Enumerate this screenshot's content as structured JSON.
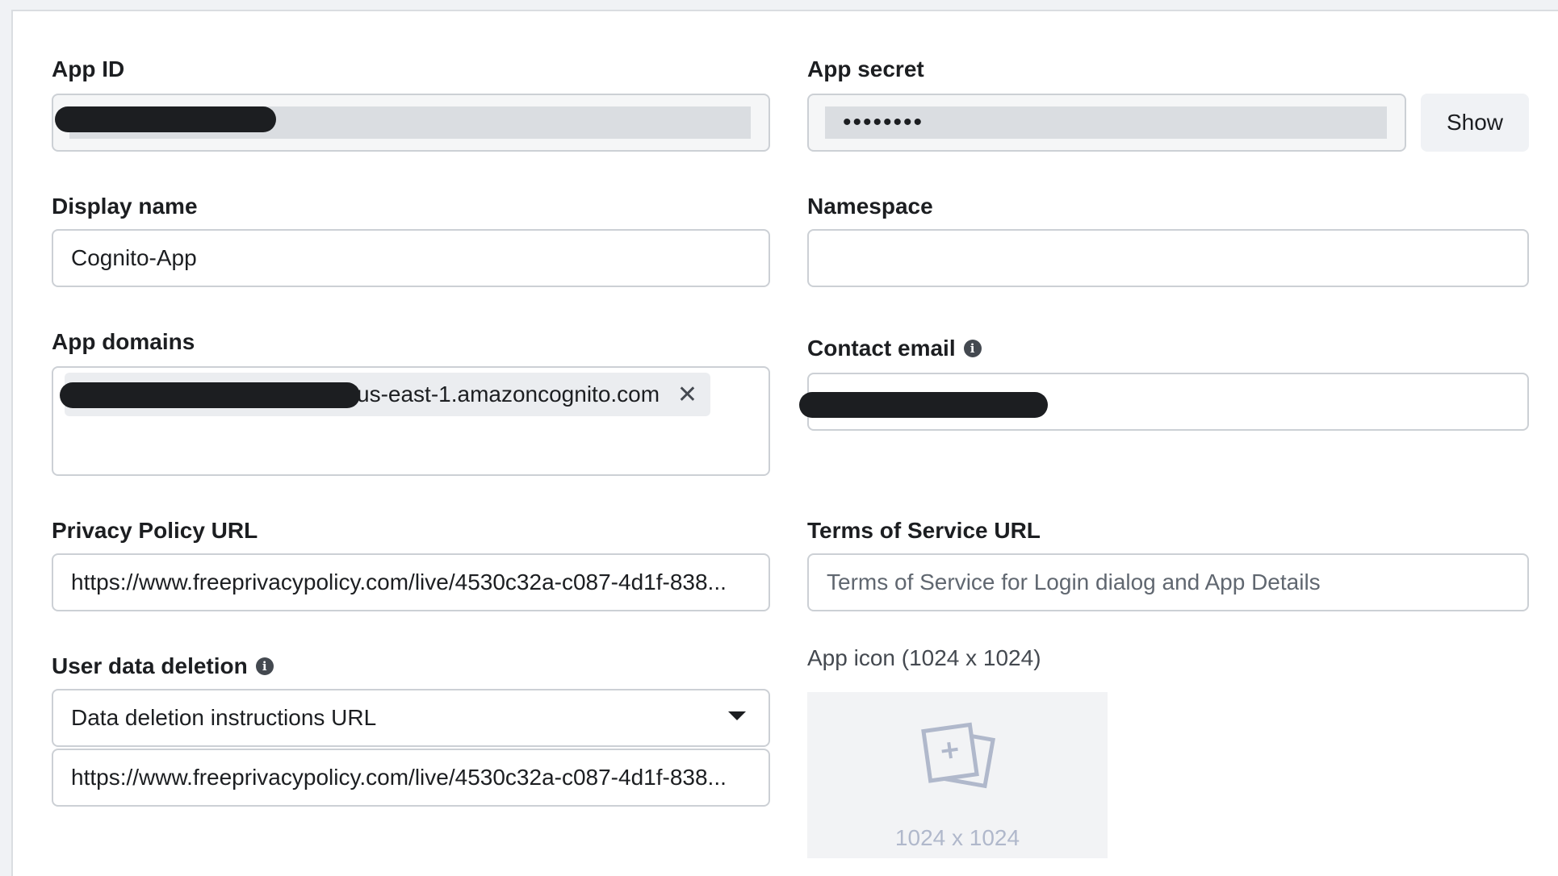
{
  "app_id": {
    "label": "App ID",
    "value": ""
  },
  "app_secret": {
    "label": "App secret",
    "value": "••••••••",
    "show_button": "Show"
  },
  "display_name": {
    "label": "Display name",
    "value": "Cognito-App"
  },
  "namespace": {
    "label": "Namespace",
    "value": ""
  },
  "app_domains": {
    "label": "App domains",
    "chips": [
      {
        "value": "us-east-1.amazoncognito.com"
      }
    ]
  },
  "contact_email": {
    "label": "Contact email",
    "value": ""
  },
  "privacy_policy_url": {
    "label": "Privacy Policy URL",
    "value": "https://www.freeprivacypolicy.com/live/4530c32a-c087-4d1f-838..."
  },
  "terms_of_service_url": {
    "label": "Terms of Service URL",
    "placeholder": "Terms of Service for Login dialog and App Details"
  },
  "user_data_deletion": {
    "label": "User data deletion",
    "selected": "Data deletion instructions URL",
    "url": "https://www.freeprivacypolicy.com/live/4530c32a-c087-4d1f-838..."
  },
  "app_icon": {
    "label": "App icon (1024 x 1024)",
    "placeholder_size": "1024 x 1024"
  },
  "icons": {
    "info": "info-icon",
    "remove": "close-icon",
    "dropdown": "caret-down-icon",
    "upload": "image-upload-icon"
  }
}
